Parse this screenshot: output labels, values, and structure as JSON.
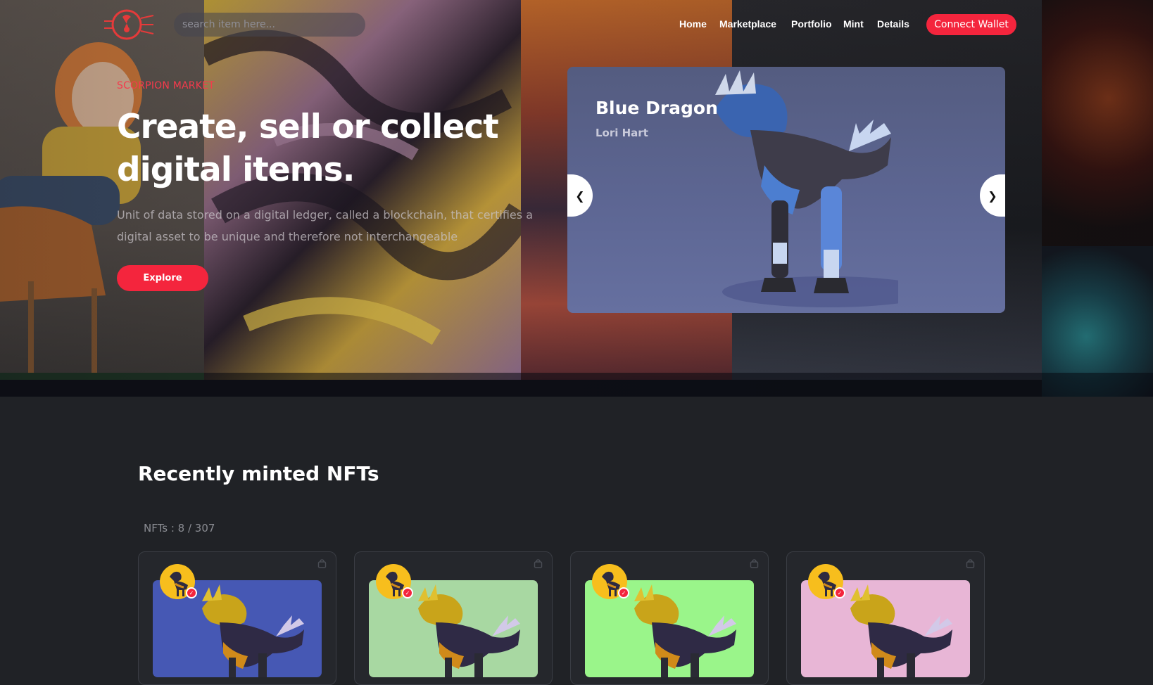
{
  "header": {
    "search_placeholder": "search item here...",
    "nav": [
      "Home",
      "Marketplace",
      "Portfolio",
      "Mint",
      "Details"
    ],
    "connect_wallet_label": "Connect Wallet"
  },
  "hero": {
    "eyebrow": "SCORPION MARKET",
    "headline_line1": "Create, sell or collect",
    "headline_line2": "digital items.",
    "description": "Unit of data stored on a digital ledger, called a blockchain, that certifies a digital asset to be unique and therefore not interchangeable",
    "explore_label": "Explore"
  },
  "carousel": {
    "title": "Blue Dragon",
    "artist": "Lori Hart",
    "prev_icon": "chevron-left-icon",
    "next_icon": "chevron-right-icon"
  },
  "recent": {
    "title": "Recently minted NFTs",
    "count_text": "NFTs : 8 / 307",
    "cards": [
      {
        "bg": "#4658b4"
      },
      {
        "bg": "#a8d8a2"
      },
      {
        "bg": "#9af58a"
      },
      {
        "bg": "#e8b6d6"
      }
    ]
  },
  "colors": {
    "accent": "#f4253d",
    "page_bg": "#202226"
  }
}
